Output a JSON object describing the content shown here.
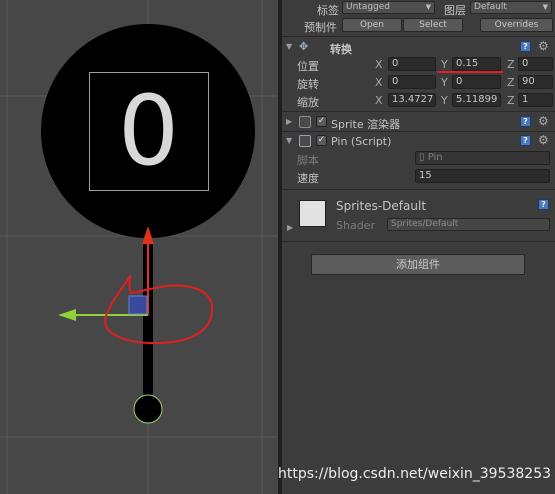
{
  "scene": {
    "counter_text": "0"
  },
  "inspector": {
    "tag_label": "标签",
    "tag_value": "Untagged",
    "layer_label": "图层",
    "layer_value": "Default",
    "prefab_label": "预制件",
    "prefab_buttons": [
      "Open",
      "Select",
      "Overrides"
    ],
    "transform": {
      "title": "转换",
      "position_label": "位置",
      "rotation_label": "旋转",
      "scale_label": "缩放",
      "axes": [
        "X",
        "Y",
        "Z"
      ],
      "position": [
        "0",
        "0.15",
        "0"
      ],
      "rotation": [
        "0",
        "0",
        "90"
      ],
      "scale": [
        "13.4727",
        "5.11899",
        "1"
      ]
    },
    "sprite_renderer": {
      "title": "Sprite 渲染器"
    },
    "pin_script": {
      "title": "Pin (Script)",
      "script_label": "脚本",
      "script_value": "Pin",
      "speed_label": "速度",
      "speed_value": "15"
    },
    "material": {
      "name": "Sprites-Default",
      "shader_label": "Shader",
      "shader_value": "Sprites/Default"
    },
    "add_component_label": "添加组件"
  },
  "watermark": "https://blog.csdn.net/weixin_39538253",
  "colors": {
    "scene_bg": "#474747",
    "inspector_bg": "#3c3c3c",
    "gizmo_y_arrow": "#e0321e",
    "gizmo_x_arrow": "#8fd13a",
    "gizmo_plane": "#3a4a9a",
    "annotation_red": "#e02020"
  }
}
